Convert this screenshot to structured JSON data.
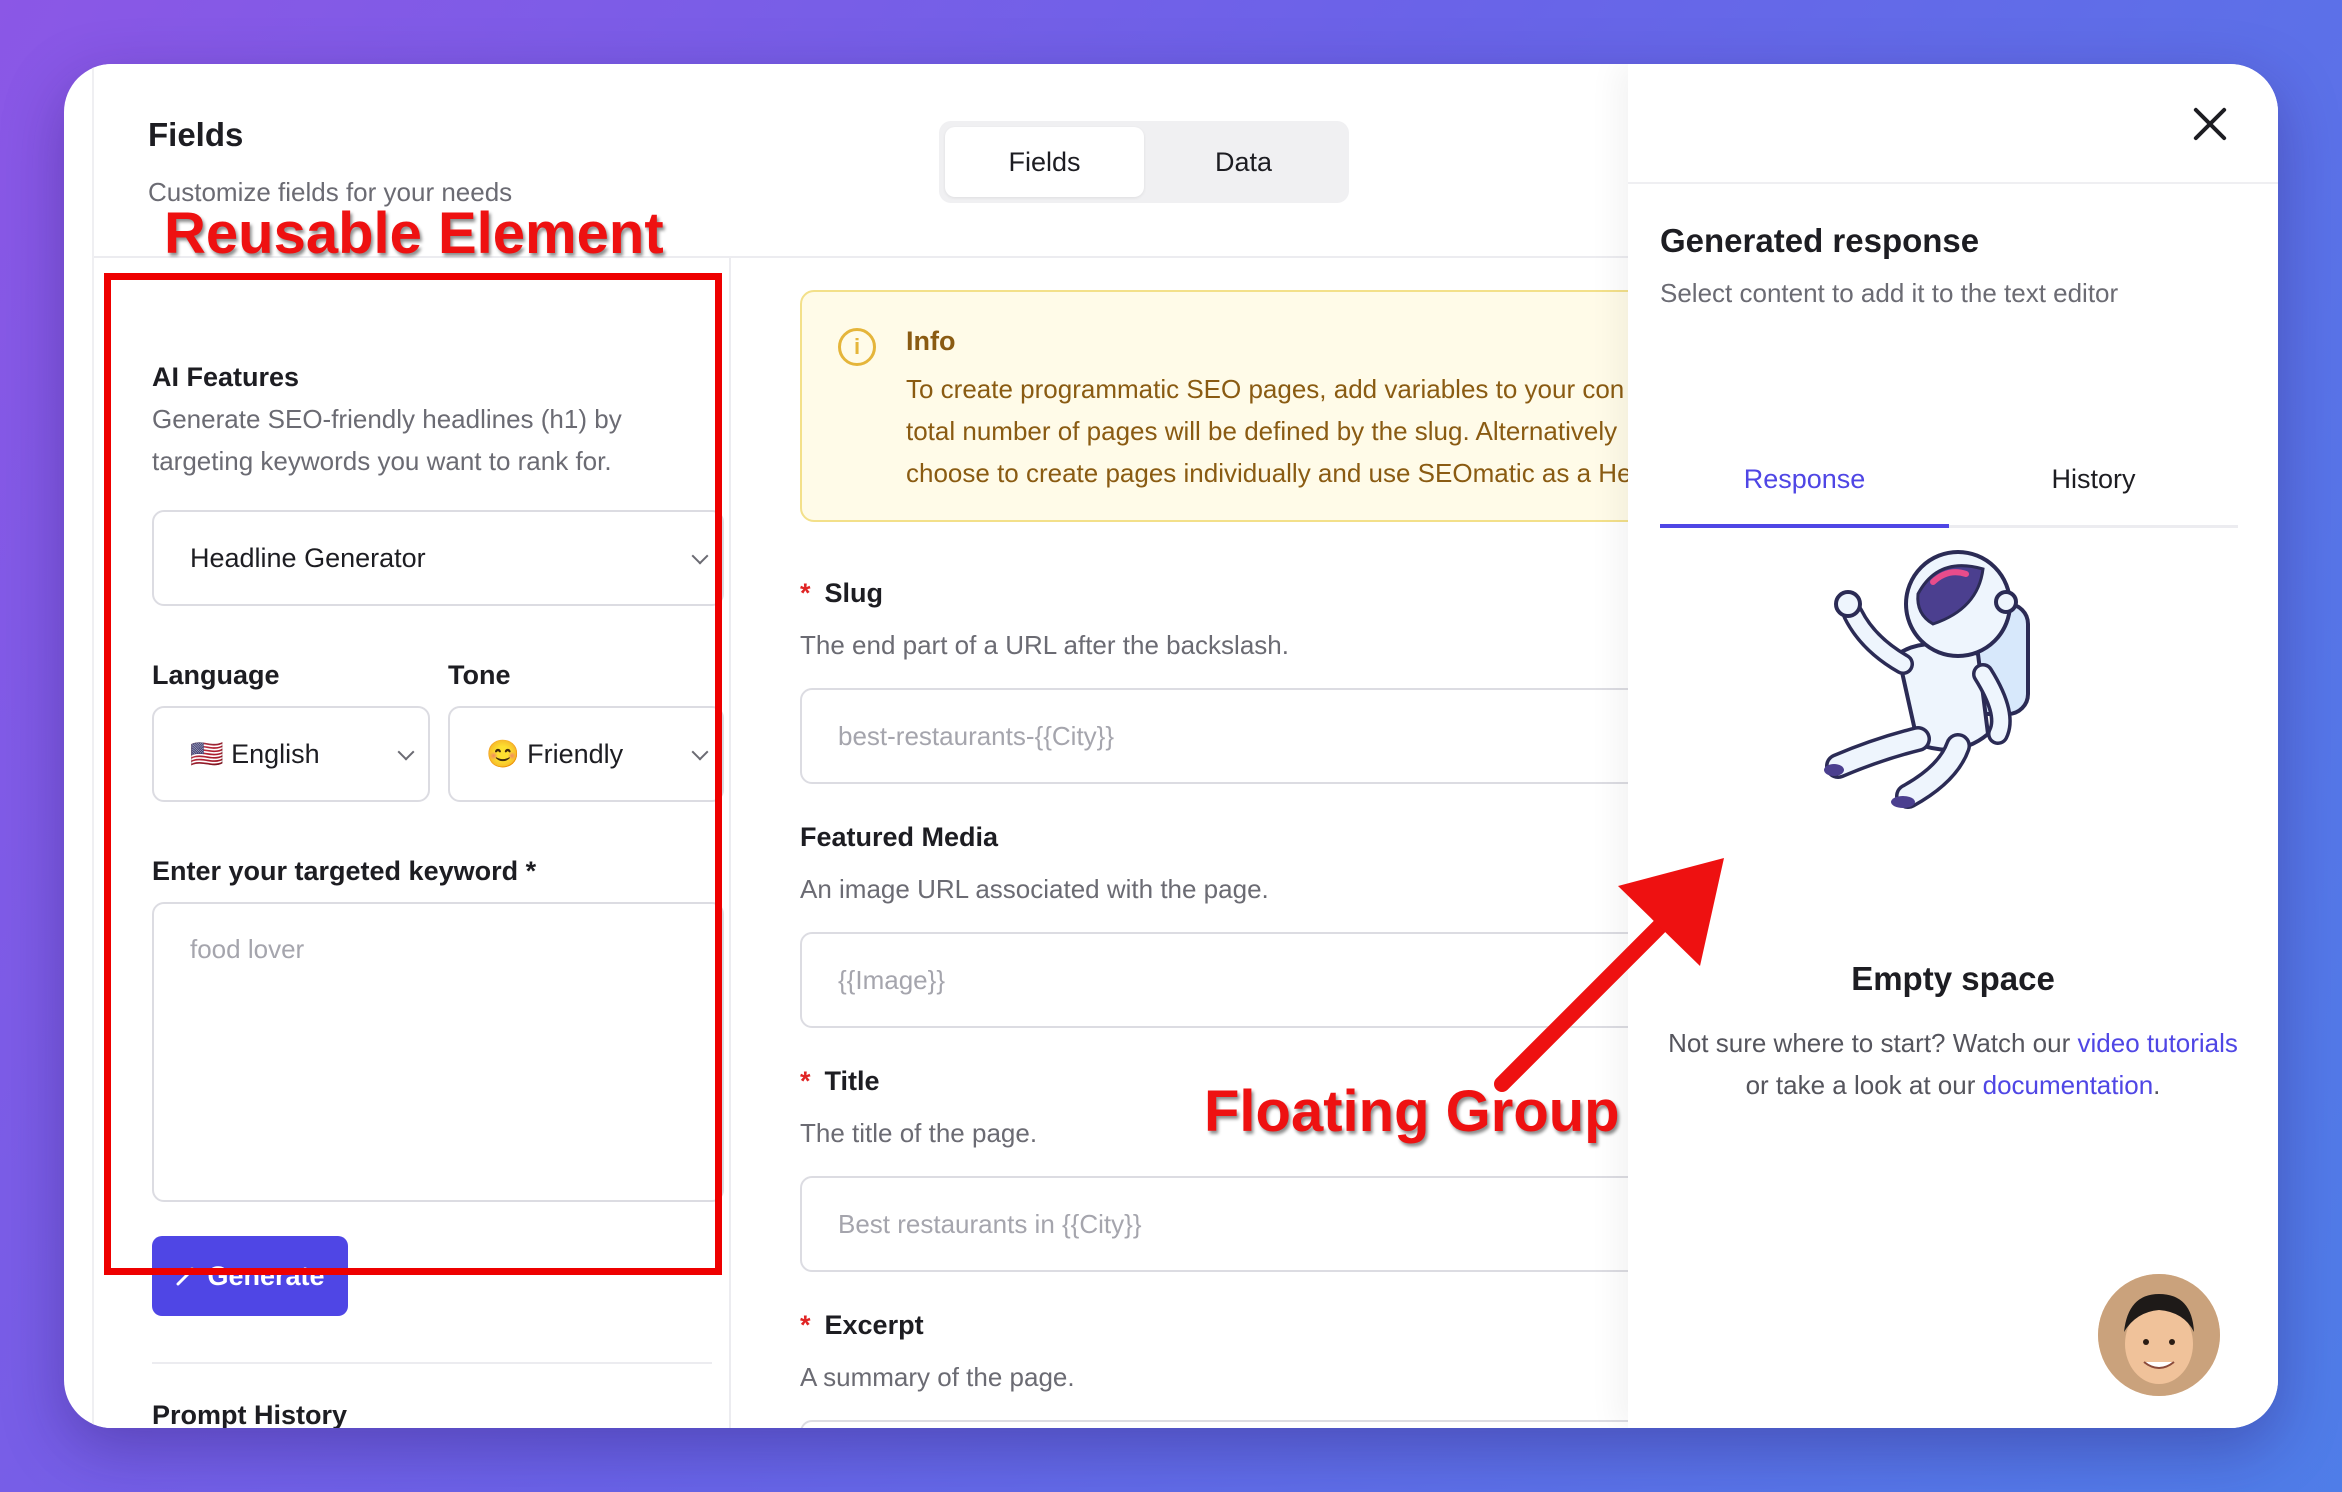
{
  "header": {
    "title": "Fields",
    "subtitle": "Customize fields for your needs"
  },
  "segmented": {
    "fields": "Fields",
    "data": "Data"
  },
  "ai": {
    "title": "AI Features",
    "description_line1": "Generate SEO-friendly headlines (h1) by",
    "description_line2": "targeting keywords you want to rank for.",
    "generator_value": "Headline Generator",
    "language_label": "Language",
    "language_value": "🇺🇸 English",
    "tone_label": "Tone",
    "tone_value": "😊 Friendly",
    "keyword_label": "Enter your targeted keyword *",
    "keyword_placeholder": "food lover",
    "generate_label": "Generate",
    "prompt_history_label": "Prompt History"
  },
  "info": {
    "title": "Info",
    "line1": "To create programmatic SEO pages, add variables to your con",
    "line2": "total number of pages will be defined by the slug. Alternatively",
    "line3": "choose to create pages individually and use SEOmatic as a He"
  },
  "fields": {
    "slug_label": "Slug",
    "slug_desc": "The end part of a URL after the backslash.",
    "slug_placeholder": "best-restaurants-{{City}}",
    "media_label": "Featured Media",
    "media_desc": "An image URL associated with the page.",
    "media_placeholder": "{{Image}}",
    "title_label": "Title",
    "title_desc": "The title of the page.",
    "title_placeholder": "Best restaurants in {{City}}",
    "excerpt_label": "Excerpt",
    "excerpt_desc": "A summary of the page.",
    "required_marker": "*"
  },
  "drawer": {
    "title": "Generated response",
    "subtitle": "Select content to add it to the text editor",
    "tab_response": "Response",
    "tab_history": "History",
    "empty_title": "Empty space",
    "empty_text_1": "Not sure where to start? Watch our ",
    "empty_link_1": "video tutorials",
    "empty_text_2": " or take a look at our ",
    "empty_link_2": "documentation",
    "empty_text_3": "."
  },
  "annotations": {
    "reusable": "Reusable Element",
    "floating": "Floating Group"
  },
  "colors": {
    "accent": "#4f46e5",
    "annotation_red": "#ee1111",
    "info_bg": "#fffbe8"
  },
  "icons": {
    "info": "info-icon",
    "close": "close-icon",
    "wand": "magic-wand-icon",
    "chevron": "chevron-down-icon"
  }
}
